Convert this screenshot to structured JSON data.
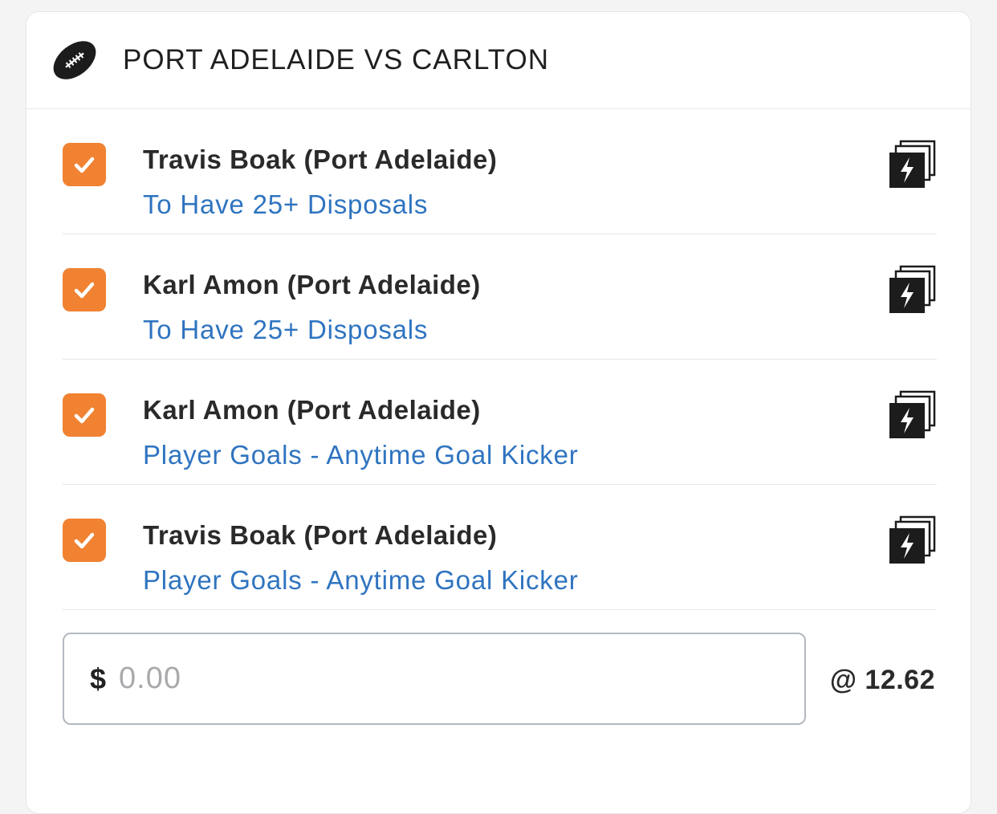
{
  "match": {
    "title": "PORT ADELAIDE VS CARLTON",
    "icon": "football-icon"
  },
  "legs": [
    {
      "checked": true,
      "name": "Travis Boak (Port Adelaide)",
      "market": "To Have 25+ Disposals",
      "badge_icon": "same-game-multi-icon"
    },
    {
      "checked": true,
      "name": "Karl Amon (Port Adelaide)",
      "market": "To Have 25+ Disposals",
      "badge_icon": "same-game-multi-icon"
    },
    {
      "checked": true,
      "name": "Karl Amon (Port Adelaide)",
      "market": "Player Goals - Anytime Goal Kicker",
      "badge_icon": "same-game-multi-icon"
    },
    {
      "checked": true,
      "name": "Travis Boak (Port Adelaide)",
      "market": "Player Goals - Anytime Goal Kicker",
      "badge_icon": "same-game-multi-icon"
    }
  ],
  "stake": {
    "currency": "$",
    "placeholder": "0.00",
    "value": ""
  },
  "odds_label": "@ 12.62",
  "colors": {
    "accent": "#f08232",
    "link": "#2f74c0",
    "text": "#2a2a2a"
  }
}
